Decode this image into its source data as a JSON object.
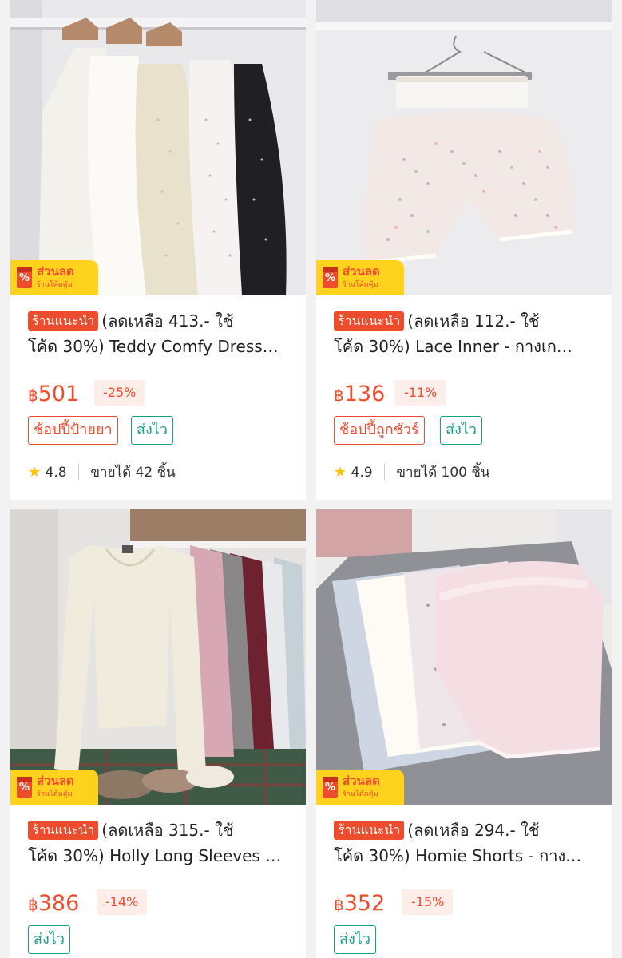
{
  "promo_badge": {
    "line1": "ส่วนลด",
    "line2": "ร้านโค้ดคุ้ม",
    "icon": "percent-tag-icon"
  },
  "products": [
    {
      "tag": "ร้านแนะนำ",
      "title_line1": "(ลดเหลือ 413.- ใช้",
      "title_line2": "โค้ด 30%) Teddy Comfy Dress…",
      "currency": "฿",
      "price": "501",
      "discount": "-25%",
      "badges": [
        {
          "label": "ช้อปปี้ป้ายยา",
          "style": "red"
        },
        {
          "label": "ส่งไว",
          "style": "teal"
        }
      ],
      "rating": "4.8",
      "sold": "ขายได้ 42 ชิ้น"
    },
    {
      "tag": "ร้านแนะนำ",
      "title_line1": "(ลดเหลือ 112.- ใช้",
      "title_line2": "โค้ด 30%) Lace Inner - กางเก…",
      "currency": "฿",
      "price": "136",
      "discount": "-11%",
      "badges": [
        {
          "label": "ช้อปปี้ถูกชัวร์",
          "style": "red"
        },
        {
          "label": "ส่งไว",
          "style": "teal"
        }
      ],
      "rating": "4.9",
      "sold": "ขายได้ 100 ชิ้น"
    },
    {
      "tag": "ร้านแนะนำ",
      "title_line1": "(ลดเหลือ 315.- ใช้",
      "title_line2": "โค้ด 30%) Holly Long Sleeves …",
      "currency": "฿",
      "price": "386",
      "discount": "-14%",
      "badges": [
        {
          "label": "ส่งไว",
          "style": "teal"
        }
      ]
    },
    {
      "tag": "ร้านแนะนำ",
      "title_line1": "(ลดเหลือ 294.- ใช้",
      "title_line2": "โค้ด 30%) Homie Shorts - กาง…",
      "currency": "฿",
      "price": "352",
      "discount": "-15%",
      "badges": [
        {
          "label": "ส่งไว",
          "style": "teal"
        }
      ]
    }
  ],
  "colors": {
    "accent": "#ee4d2d",
    "teal": "#1aa18c",
    "star": "#ffc107",
    "promo_bg": "#ffd21e"
  }
}
